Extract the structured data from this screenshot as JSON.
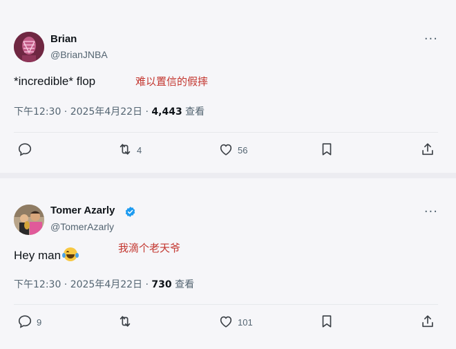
{
  "tweets": [
    {
      "name": "Brian",
      "handle": "@BrianJNBA",
      "text": "*incredible* flop",
      "annotation": "难以置信的假摔",
      "time": "下午12:30 · 2025年4月22日 · ",
      "views": "4,443",
      "views_label": " 查看",
      "replies": "",
      "retweets": "4",
      "likes": "56",
      "verified": false,
      "more": "···"
    },
    {
      "name": "Tomer Azarly",
      "handle": "@TomerAzarly",
      "text": "Hey man",
      "annotation": "我滴个老天爷",
      "time": "下午12:30 · 2025年4月22日 · ",
      "views": "730",
      "views_label": " 查看",
      "replies": "9",
      "retweets": "",
      "likes": "101",
      "verified": true,
      "more": "···"
    }
  ],
  "icons": {
    "reply": "reply-icon",
    "retweet": "retweet-icon",
    "like": "heart-icon",
    "bookmark": "bookmark-icon",
    "share": "share-icon",
    "more": "more-icon",
    "verified": "verified-badge-icon",
    "emoji": "tears-of-joy-emoji-icon"
  },
  "colors": {
    "annotation": "#c3352e",
    "verified": "#1d9bf0",
    "text": "#0f1419",
    "secondary": "#536471"
  }
}
